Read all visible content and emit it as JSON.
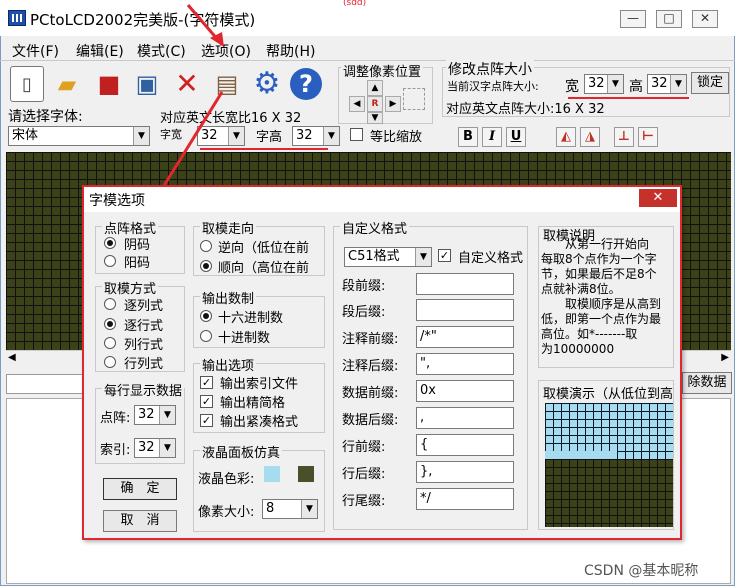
{
  "app": {
    "title": "PCtoLCD2002完美版-(字符模式)",
    "caption_min": "—",
    "caption_max": "□",
    "caption_close": "✕"
  },
  "watermark_top": "(sdd)",
  "menu": [
    "文件(F)",
    "编辑(E)",
    "模式(C)",
    "选项(O)",
    "帮助(H)"
  ],
  "toolbar": {
    "icons": [
      "new-file-icon",
      "open-folder-icon",
      "save-icon",
      "generate-icon",
      "delete-icon",
      "notepad-icon",
      "settings-gear-icon",
      "help-icon"
    ],
    "pixel_adjust_label": "调整像素位置",
    "dot_size_label": "修改点阵大小",
    "current_size_label": "当前汉字点阵大小:",
    "width_label": "宽",
    "width_value": "32",
    "height_label": "高",
    "height_value": "32",
    "lock_label": "锁定",
    "english_size_text": "对应英文点阵大小:16 X 32"
  },
  "font": {
    "select_label": "请选择字体:",
    "font_value": "宋体",
    "english_size_text": "对应英文长宽比16 X 32",
    "char_width_label": "字宽",
    "char_width_value": "32",
    "char_height_label": "字高",
    "char_height_value": "32",
    "proportional_label": "等比缩放",
    "bold_label": "B",
    "italic_label": "I",
    "underline_label": "U"
  },
  "bottom_button": "除数据",
  "dialog": {
    "title": "字模选项",
    "close": "✕",
    "dot_format": {
      "title": "点阵格式",
      "options": [
        "阴码",
        "阳码"
      ],
      "selected": 0
    },
    "mode": {
      "title": "取模方式",
      "options": [
        "逐列式",
        "逐行式",
        "列行式",
        "行列式"
      ],
      "selected": 1
    },
    "per_line": {
      "title": "每行显示数据",
      "dots_label": "点阵:",
      "dots_value": "32",
      "index_label": "索引:",
      "index_value": "32"
    },
    "confirm": "确　定",
    "cancel": "取　消",
    "direction": {
      "title": "取模走向",
      "options": [
        "逆向（低位在前",
        "顺向（高位在前"
      ],
      "selected": 1
    },
    "output_base": {
      "title": "输出数制",
      "options": [
        "十六进制数",
        "十进制数"
      ],
      "selected": 0
    },
    "output_opts": {
      "title": "输出选项",
      "options": [
        "输出索引文件",
        "输出精简格",
        "输出紧凑格式"
      ]
    },
    "lcd": {
      "title": "液晶面板仿真",
      "color_label": "液晶色彩:",
      "color_fg": "#a6dcf0",
      "color_bg": "#4a4f2b",
      "pixel_label": "像素大小:",
      "pixel_value": "8"
    },
    "custom": {
      "title": "自定义格式",
      "format_value": "C51格式",
      "custom_check_label": "自定义格式",
      "rows": [
        {
          "label": "段前缀:",
          "value": ""
        },
        {
          "label": "段后缀:",
          "value": ""
        },
        {
          "label": "注释前缀:",
          "value": "/*\""
        },
        {
          "label": "注释后缀:",
          "value": "\","
        },
        {
          "label": "数据前缀:",
          "value": "0x"
        },
        {
          "label": "数据后缀:",
          "value": ","
        },
        {
          "label": "行前缀:",
          "value": "{"
        },
        {
          "label": "行后缀:",
          "value": "},"
        },
        {
          "label": "行尾缀:",
          "value": "*/"
        }
      ]
    },
    "desc": {
      "title": "取模说明",
      "lines": [
        "　　从第一行开始向",
        "每取8个点作为一个字",
        "节，如果最后不足8个",
        "点就补满8位。",
        "　　取模顺序是从高到",
        "低，即第一个点作为最",
        "高位。如*-------取",
        "为10000000"
      ]
    },
    "demo": {
      "title": "取模演示（从低位到高位"
    }
  },
  "footer_watermark": "CSDN @基本昵称",
  "colors": {
    "highlight": "#e0262e",
    "lcd_bg": "#3b4217",
    "lcd_fg": "#a6dcf0"
  }
}
